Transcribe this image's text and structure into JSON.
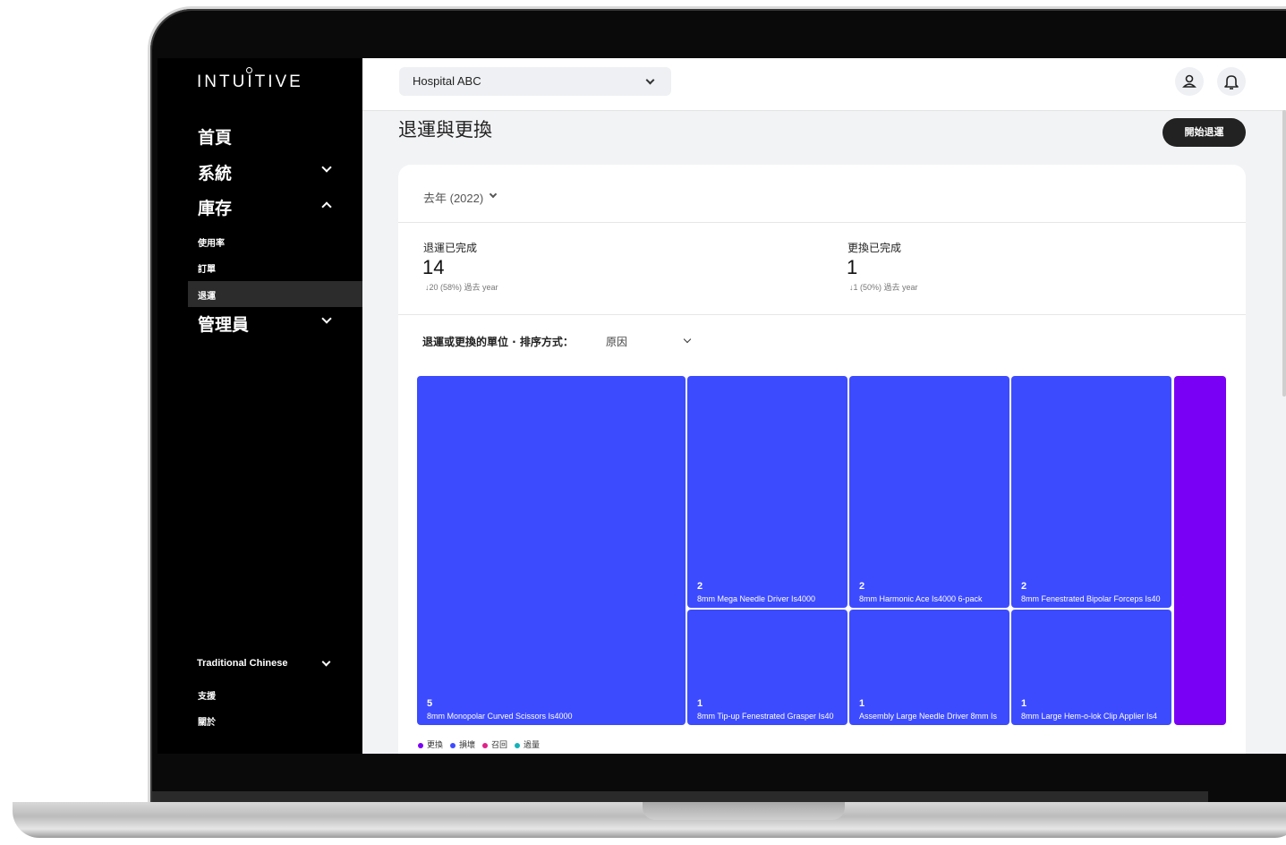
{
  "brand": {
    "logo_text": "INTUITIVE"
  },
  "sidebar": {
    "nav": [
      {
        "label": "首頁"
      },
      {
        "label": "系統"
      },
      {
        "label": "庫存"
      },
      {
        "label": "管理員"
      }
    ],
    "sub_items": [
      {
        "label": "使用率"
      },
      {
        "label": "訂單"
      },
      {
        "label": "退運",
        "active": true
      }
    ],
    "language": "Traditional Chinese",
    "footer_links": [
      {
        "label": "支援"
      },
      {
        "label": "關於"
      }
    ]
  },
  "topbar": {
    "hospital_select": "Hospital ABC",
    "icons": [
      "user-icon",
      "bell-icon"
    ]
  },
  "page": {
    "title": "退運與更換",
    "primary_button": "開始退運"
  },
  "card": {
    "period": "去年 (2022)",
    "stats": [
      {
        "label": "退運已完成",
        "value": "14",
        "delta": "↓20 (58%) 過去 year"
      },
      {
        "label": "更換已完成",
        "value": "1",
        "delta": "↓1 (50%) 過去 year"
      }
    ],
    "sort_label": "退運或更換的單位 · 排序方式：",
    "sort_value": "原因"
  },
  "chart_data": {
    "type": "treemap",
    "items": [
      {
        "name": "8mm Monopolar Curved Scissors Is4000",
        "value": 5,
        "category": "損壞"
      },
      {
        "name": "8mm Mega Needle Driver Is4000",
        "value": 2,
        "category": "損壞"
      },
      {
        "name": "8mm Harmonic Ace Is4000 6-pack",
        "value": 2,
        "category": "損壞"
      },
      {
        "name": "8mm Fenestrated Bipolar Forceps Is40",
        "value": 2,
        "category": "損壞"
      },
      {
        "name": "8mm Tip-up Fenestrated Grasper Is40",
        "value": 1,
        "category": "損壞"
      },
      {
        "name": "Assembly Large Needle Driver 8mm Is",
        "value": 1,
        "category": "損壞"
      },
      {
        "name": "8mm Large Hem-o-lok Clip Applier Is4",
        "value": 1,
        "category": "損壞"
      },
      {
        "name": "",
        "value": null,
        "category": "更換"
      }
    ],
    "legend": [
      {
        "label": "更換",
        "color": "#7a00f5"
      },
      {
        "label": "損壞",
        "color": "#3d4bff"
      },
      {
        "label": "召回",
        "color": "#e0218a"
      },
      {
        "label": "過量",
        "color": "#14b2b8"
      }
    ]
  }
}
